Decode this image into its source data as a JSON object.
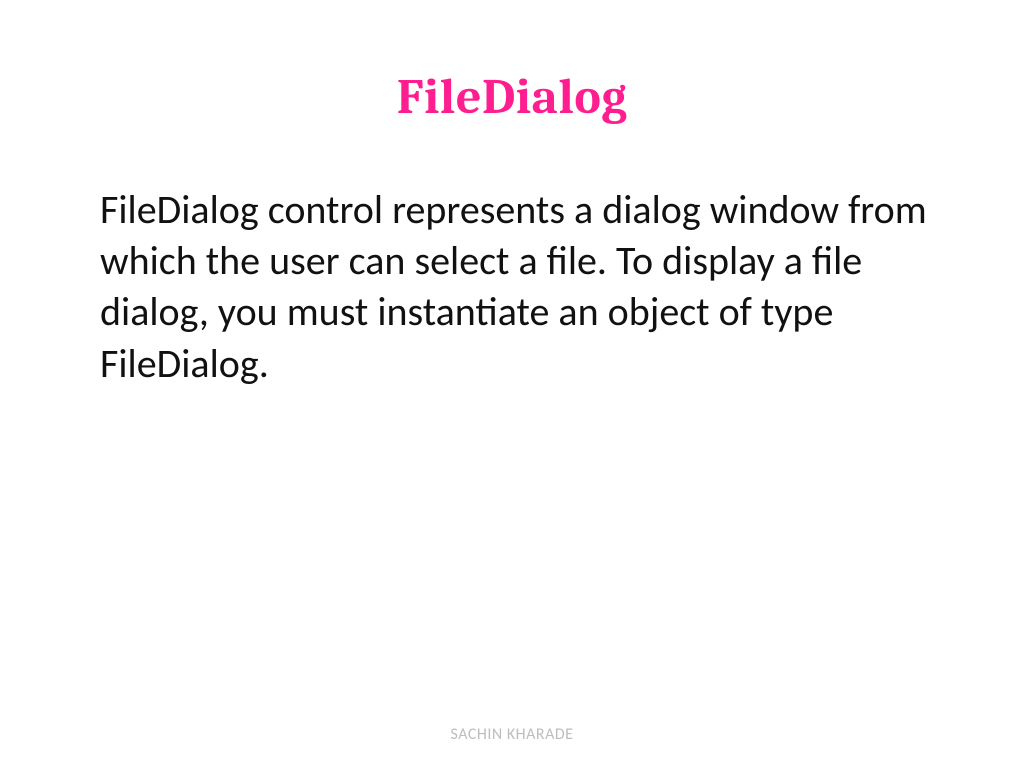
{
  "slide": {
    "title": "FileDialog",
    "body": "FileDialog control represents a dialog window from which the user can select a file. To display a file dialog, you must instantiate an object of type FileDialog.",
    "footer": "SACHIN KHARADE"
  }
}
